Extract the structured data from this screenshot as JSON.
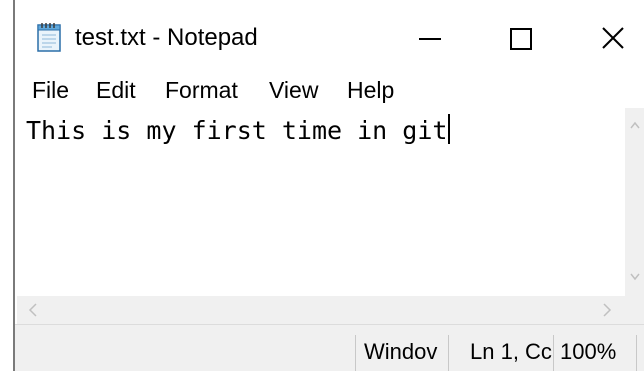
{
  "window": {
    "title": "test.txt - Notepad",
    "icon": "notepad-icon",
    "controls": {
      "minimize_icon": "minimize-icon",
      "maximize_icon": "maximize-icon",
      "close_icon": "close-icon"
    }
  },
  "menu": {
    "items": [
      {
        "label": "File"
      },
      {
        "label": "Edit"
      },
      {
        "label": "Format"
      },
      {
        "label": "View"
      },
      {
        "label": "Help"
      }
    ]
  },
  "editor": {
    "content": "This is my first time in git"
  },
  "status": {
    "encoding": "Windov",
    "position": "Ln 1, Cc",
    "zoom": "100%"
  },
  "colors": {
    "window_bg": "#ffffff",
    "chrome_bg": "#f0f0f0",
    "text": "#000000",
    "border": "#7a7a7a"
  }
}
